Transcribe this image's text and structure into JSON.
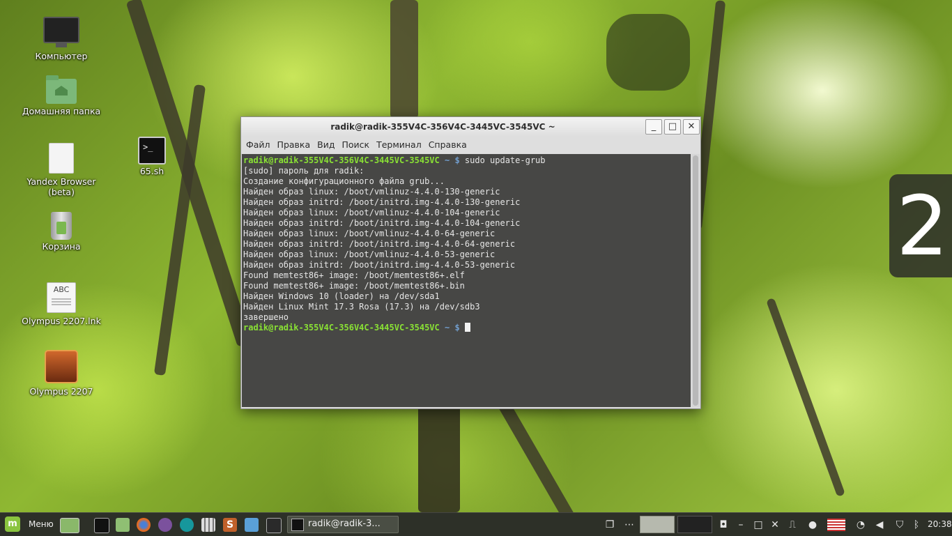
{
  "desktop": {
    "icons": [
      {
        "label": "Компьютер",
        "icon": "computer-icon"
      },
      {
        "label": "Домашняя папка",
        "icon": "home-folder-icon"
      },
      {
        "label": "Yandex Browser (beta)",
        "icon": "document-icon"
      },
      {
        "label": "65.sh",
        "icon": "terminal-script-icon",
        "glyph": ">_"
      },
      {
        "label": "Корзина",
        "icon": "trash-icon"
      },
      {
        "label": "Olympus 2207.lnk",
        "icon": "text-file-icon",
        "glyph": "ABC"
      },
      {
        "label": "Olympus 2207",
        "icon": "game-icon"
      }
    ],
    "clock_widget": "2"
  },
  "terminal": {
    "title": "radik@radik-355V4C-356V4C-3445VC-3545VC ~",
    "buttons": {
      "minimize": "_",
      "maximize": "□",
      "close": "✕"
    },
    "menu": [
      "Файл",
      "Правка",
      "Вид",
      "Поиск",
      "Терминал",
      "Справка"
    ],
    "prompt_user": "radik@radik-355V4C-356V4C-3445VC-3545VC",
    "prompt_tail": " ~ $",
    "command": " sudo update-grub",
    "output": [
      "[sudo] пароль для radik:",
      "Создание конфигурационного файла grub...",
      "Найден образ linux: /boot/vmlinuz-4.4.0-130-generic",
      "Найден образ initrd: /boot/initrd.img-4.4.0-130-generic",
      "Найден образ linux: /boot/vmlinuz-4.4.0-104-generic",
      "Найден образ initrd: /boot/initrd.img-4.4.0-104-generic",
      "Найден образ linux: /boot/vmlinuz-4.4.0-64-generic",
      "Найден образ initrd: /boot/initrd.img-4.4.0-64-generic",
      "Найден образ linux: /boot/vmlinuz-4.4.0-53-generic",
      "Найден образ initrd: /boot/initrd.img-4.4.0-53-generic",
      "Found memtest86+ image: /boot/memtest86+.elf",
      "Found memtest86+ image: /boot/memtest86+.bin",
      "Найден Windows 10 (loader) на /dev/sda1",
      "Найден Linux Mint 17.3 Rosa (17.3) на /dev/sdb3",
      "завершено"
    ],
    "colors": {
      "background": "#3e3e3c",
      "prompt_user": "#8ae234",
      "prompt_tilde": "#729fcf",
      "text": "#e6e6e6"
    }
  },
  "taskbar": {
    "menu_label": "Меню",
    "launchers": [
      "show-desktop-icon",
      "terminal-icon",
      "files-icon",
      "firefox-icon",
      "viber-icon",
      "arduino-icon",
      "calculator-icon",
      "s-app-icon",
      "system-monitor-icon",
      "oscilloscope-icon"
    ],
    "window_button": "radik@radik-3...",
    "tray": [
      "window-list-icon",
      "dots-icon",
      "workspace-1",
      "workspace-2",
      "camera-icon",
      "minimize-icon",
      "maximize-icon",
      "close-icon",
      "usb-icon",
      "user-icon",
      "us-flag-icon",
      "wifi-icon",
      "volume-icon",
      "shield-icon",
      "bluetooth-icon"
    ],
    "time": "20:38"
  }
}
